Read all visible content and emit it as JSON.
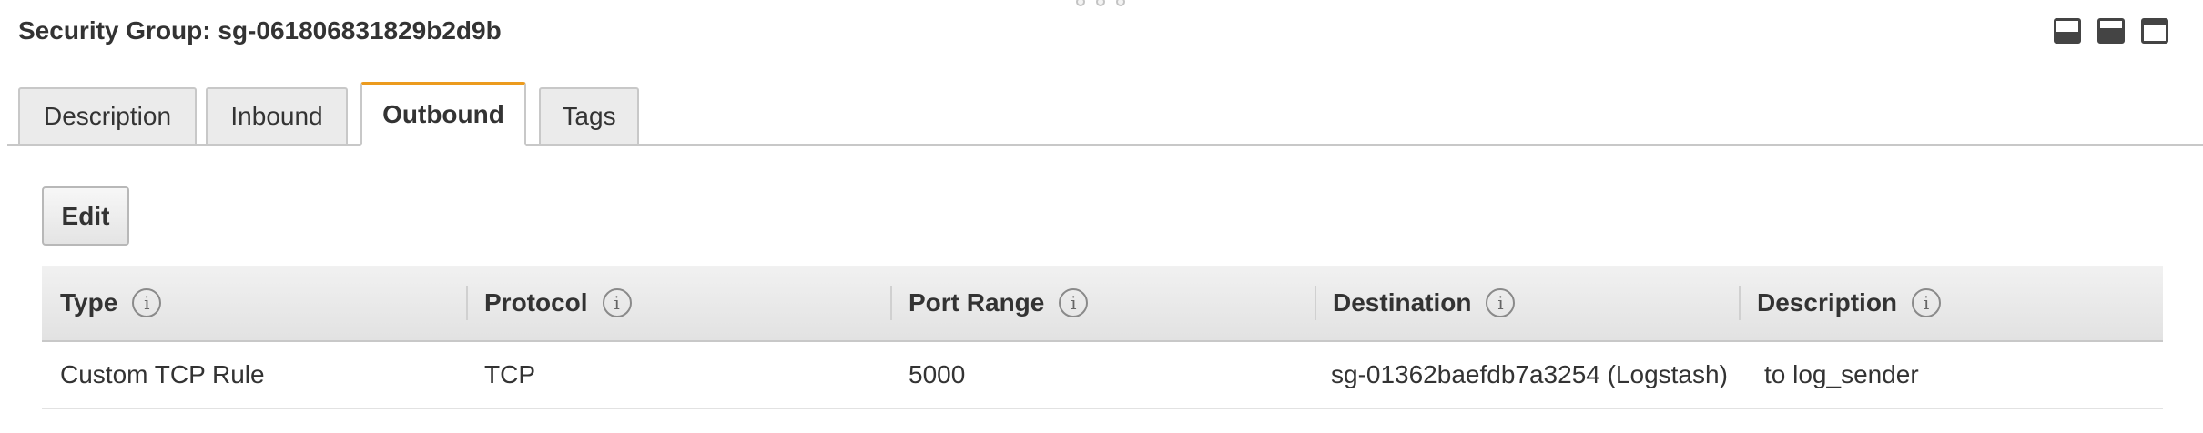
{
  "header": {
    "title": "Security Group: sg-061806831829b2d9b"
  },
  "view_controls": [
    {
      "name": "dock-bottom-icon"
    },
    {
      "name": "dock-half-icon"
    },
    {
      "name": "dock-full-icon"
    }
  ],
  "tabs": [
    {
      "label": "Description",
      "active": false
    },
    {
      "label": "Inbound",
      "active": false
    },
    {
      "label": "Outbound",
      "active": true
    },
    {
      "label": "Tags",
      "active": false
    }
  ],
  "toolbar": {
    "edit_label": "Edit"
  },
  "table": {
    "columns": [
      "Type",
      "Protocol",
      "Port Range",
      "Destination",
      "Description"
    ],
    "info_glyph": "i",
    "rows": [
      [
        "Custom TCP Rule",
        "TCP",
        "5000",
        "sg-01362baefdb7a3254 (Logstash)",
        "to log_sender"
      ]
    ]
  },
  "colors": {
    "active_tab_accent": "#ec9b1e",
    "header_bg": "#e2e2e2",
    "text": "#333333"
  }
}
